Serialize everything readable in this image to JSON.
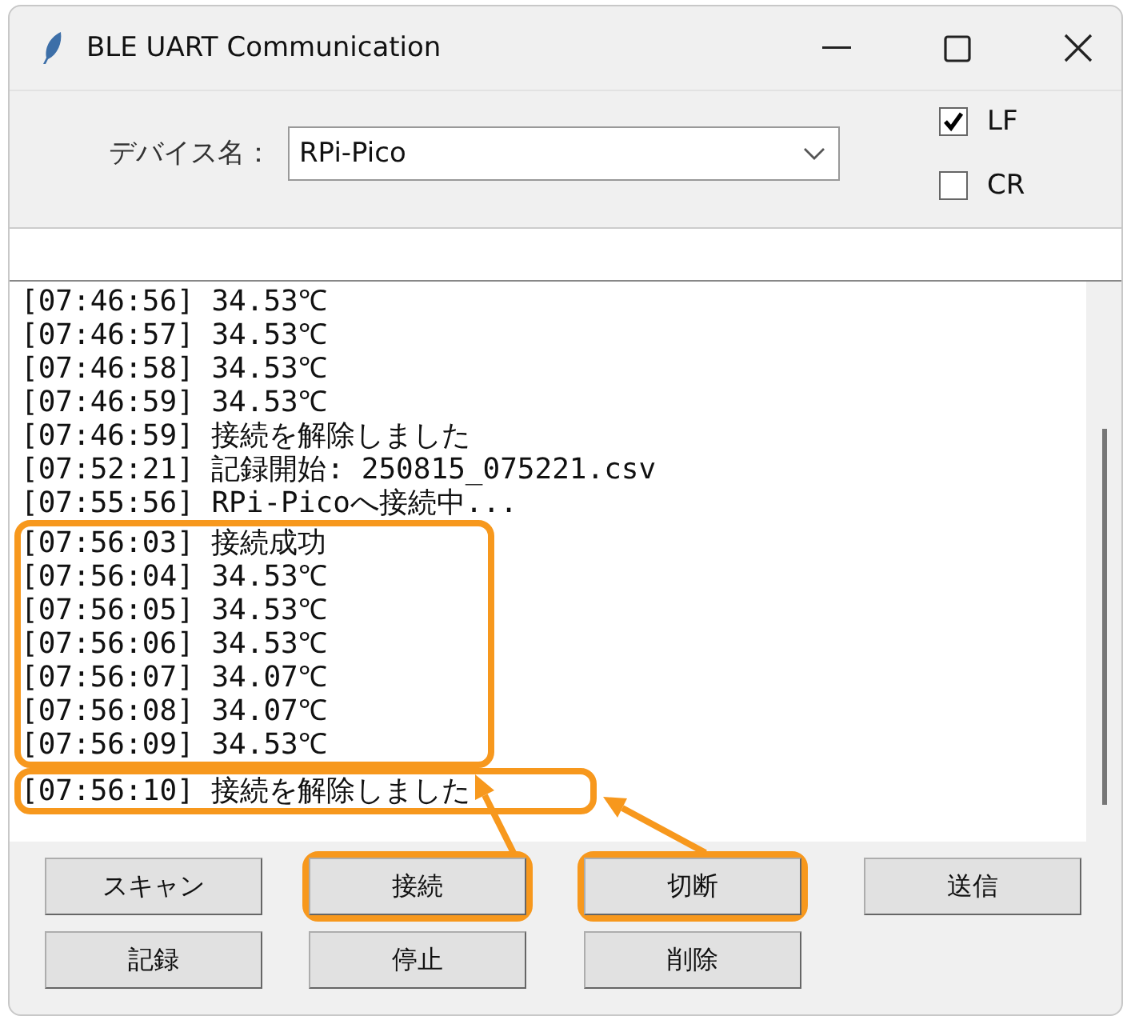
{
  "window": {
    "title": "BLE UART Communication"
  },
  "device": {
    "label": "デバイス名：",
    "value": "RPi-Pico"
  },
  "options": [
    {
      "label": "LF",
      "checked": true
    },
    {
      "label": "CR",
      "checked": false
    }
  ],
  "log": {
    "blocks": [
      {
        "highlighted": false,
        "lines": [
          "[07:46:56] 34.53℃",
          "[07:46:57] 34.53℃",
          "[07:46:58] 34.53℃",
          "[07:46:59] 34.53℃",
          "[07:46:59] 接続を解除しました",
          "[07:52:21] 記録開始: 250815_075221.csv",
          "[07:55:56] RPi-Picoへ接続中..."
        ]
      },
      {
        "highlighted": true,
        "lines": [
          "[07:56:03] 接続成功",
          "[07:56:04] 34.53℃",
          "[07:56:05] 34.53℃",
          "[07:56:06] 34.53℃",
          "[07:56:07] 34.07℃",
          "[07:56:08] 34.07℃",
          "[07:56:09] 34.53℃"
        ]
      },
      {
        "highlighted": true,
        "lines": [
          "[07:56:10] 接続を解除しました"
        ]
      }
    ]
  },
  "buttons": [
    {
      "label": "スキャン",
      "highlighted": false
    },
    {
      "label": "接続",
      "highlighted": true
    },
    {
      "label": "切断",
      "highlighted": true
    },
    {
      "label": "送信",
      "highlighted": false
    },
    {
      "label": "記録",
      "highlighted": false
    },
    {
      "label": "停止",
      "highlighted": false
    },
    {
      "label": "削除",
      "highlighted": false
    }
  ]
}
